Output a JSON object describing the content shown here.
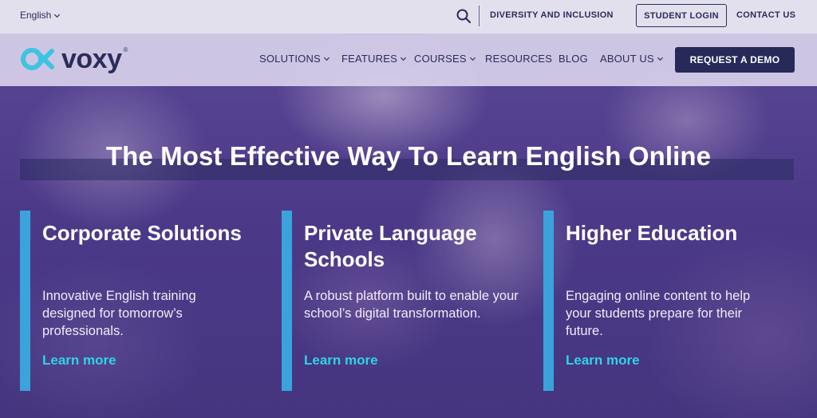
{
  "topbar": {
    "language": "English",
    "diversity_link": "DIVERSITY AND INCLUSION",
    "student_login": "STUDENT LOGIN",
    "contact_us": "CONTACT US"
  },
  "brand": {
    "name": "voxy",
    "reg_mark": "®",
    "colors": {
      "navy": "#2b2c5a",
      "cyan": "#2fd3e6",
      "accent_bar": "#3aa3dc",
      "purple": "#4d3a86"
    }
  },
  "nav": {
    "items": [
      {
        "label": "SOLUTIONS",
        "dropdown": true
      },
      {
        "label": "FEATURES",
        "dropdown": true
      },
      {
        "label": "COURSES",
        "dropdown": true
      },
      {
        "label": "RESOURCES",
        "dropdown": false
      },
      {
        "label": "BLOG",
        "dropdown": false
      },
      {
        "label": "ABOUT US",
        "dropdown": true
      }
    ],
    "cta": "REQUEST A DEMO"
  },
  "hero": {
    "headline": "The Most Effective Way To Learn English Online",
    "cards": [
      {
        "title": "Corporate Solutions",
        "description": "Innovative English training designed for tomorrow’s professionals.",
        "link": "Learn more"
      },
      {
        "title": "Private Language Schools",
        "description": "A robust platform built to enable your school’s digital transformation.",
        "link": "Learn more"
      },
      {
        "title": "Higher Education",
        "description": "Engaging online content to help your students prepare for their future.",
        "link": "Learn more"
      }
    ]
  },
  "icons": [
    "chevron-down-icon",
    "search-icon",
    "voxy-logo-icon"
  ]
}
